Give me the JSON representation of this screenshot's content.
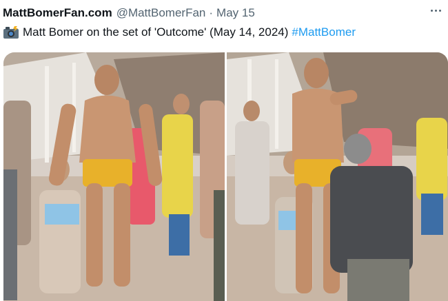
{
  "tweet": {
    "author_name": "MattBomerFan.com",
    "handle": "@MattBomerFan",
    "separator": "·",
    "date": "May 15",
    "text": "Matt Bomer on the set of 'Outcome' (May 14, 2024)",
    "hashtag": "#MattBomer",
    "emoji_icon": "camera-with-flash-icon",
    "more_icon": "more-options-icon"
  },
  "media": {
    "photo_count": 2,
    "photos": [
      {
        "subject": "beach-set-photo-1"
      },
      {
        "subject": "beach-set-photo-2"
      }
    ]
  },
  "colors": {
    "text": "#0f1419",
    "secondary": "#536471",
    "link": "#1d9bf0"
  }
}
